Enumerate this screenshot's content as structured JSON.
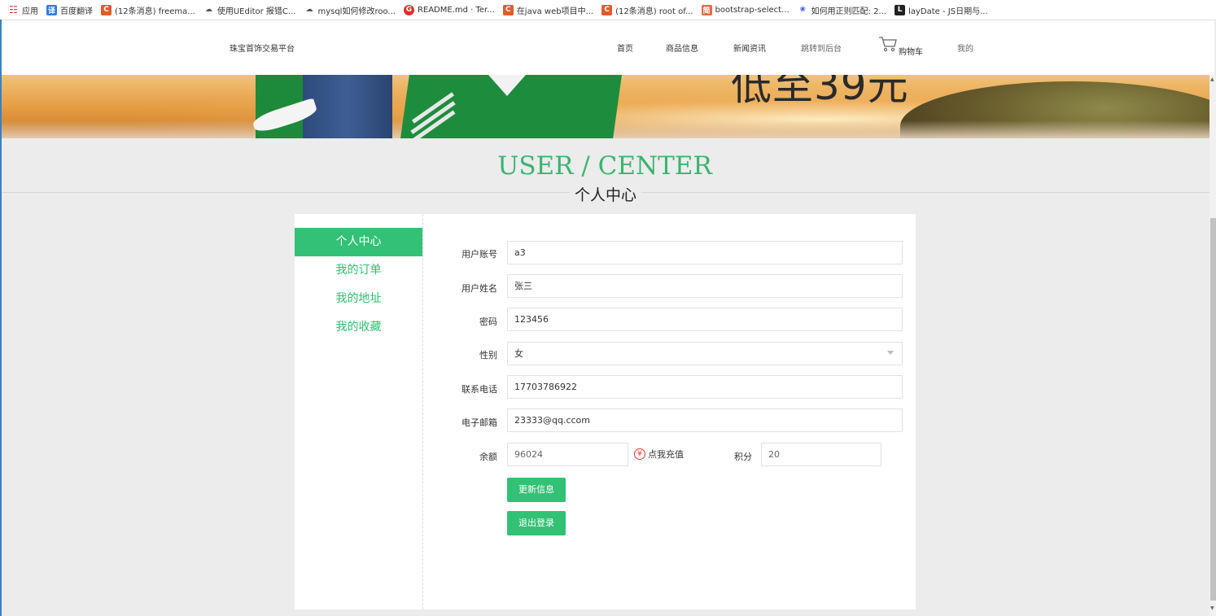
{
  "bookmarks": [
    {
      "label": "应用",
      "icon": "apps-grid-icon",
      "color": "#4285f4"
    },
    {
      "label": "百度翻译",
      "icon": "baidu-translate-icon",
      "color": "#2f7de1"
    },
    {
      "label": "(12条消息) freema...",
      "icon": "csdn-icon",
      "color": "#e25c2a"
    },
    {
      "label": "使用UEditor 报错C...",
      "icon": "cloud-icon",
      "color": "#666666"
    },
    {
      "label": "mysql如何修改roo...",
      "icon": "cloud-icon",
      "color": "#666666"
    },
    {
      "label": "README.md · Ter...",
      "icon": "gitee-icon",
      "color": "#d9302c"
    },
    {
      "label": "在java web项目中...",
      "icon": "csdn-icon",
      "color": "#e25c2a"
    },
    {
      "label": "(12条消息) root of...",
      "icon": "csdn-icon",
      "color": "#e25c2a"
    },
    {
      "label": "bootstrap-select...",
      "icon": "jianshu-icon",
      "color": "#e9694b"
    },
    {
      "label": "如何用正则匹配: 2...",
      "icon": "baidu-paw-icon",
      "color": "#2f54eb"
    },
    {
      "label": "layDate - JS日期与...",
      "icon": "layui-icon",
      "color": "#222222"
    }
  ],
  "header": {
    "brand": "珠宝首饰交易平台",
    "nav": {
      "home": "首页",
      "products": "商品信息",
      "news": "新闻资讯",
      "admin": "跳转到后台",
      "cart": "购物车",
      "mine": "我的"
    }
  },
  "banner": {
    "text": "低至39元"
  },
  "section": {
    "title_en": "USER / CENTER",
    "title_cn": "个人中心"
  },
  "sidebar": {
    "items": [
      {
        "label": "个人中心",
        "active": true
      },
      {
        "label": "我的订单",
        "active": false
      },
      {
        "label": "我的地址",
        "active": false
      },
      {
        "label": "我的收藏",
        "active": false
      }
    ]
  },
  "form": {
    "account_label": "用户账号",
    "account_value": "a3",
    "name_label": "用户姓名",
    "name_value": "张三",
    "password_label": "密码",
    "password_value": "123456",
    "gender_label": "性别",
    "gender_value": "女",
    "phone_label": "联系电话",
    "phone_value": "17703786922",
    "email_label": "电子邮箱",
    "email_value": "23333@qq.ccom",
    "balance_label": "余额",
    "balance_value": "96024",
    "recharge_label": "点我充值",
    "points_label": "积分",
    "points_value": "20",
    "update_button": "更新信息",
    "logout_button": "退出登录"
  },
  "colors": {
    "accent": "#32c175",
    "title_green": "#3cb371"
  }
}
